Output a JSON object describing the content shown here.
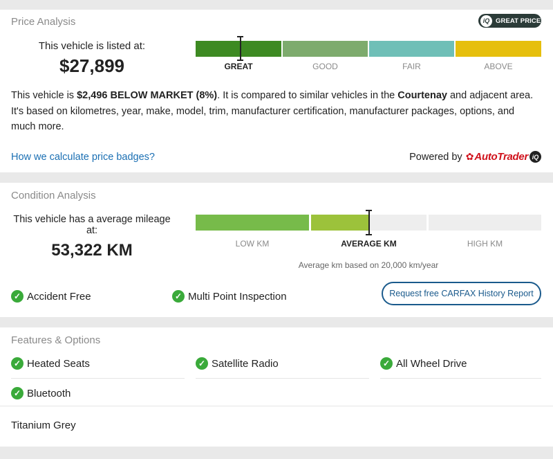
{
  "price_analysis": {
    "title": "Price Analysis",
    "badge": {
      "icon": "iq-icon",
      "iq": "iQ",
      "text": "GREAT PRICE"
    },
    "listed_label": "This vehicle is listed at:",
    "price": "$27,899",
    "bar_labels": [
      "GREAT",
      "GOOD",
      "FAIR",
      "ABOVE"
    ],
    "active_segment": "GREAT",
    "desc_pre": "This vehicle is ",
    "desc_amount": "$2,496 BELOW MARKET (8%)",
    "desc_mid": ". It is compared to similar vehicles in the ",
    "desc_city": "Courtenay",
    "desc_post": " and adjacent area. It's based on kilometres, year, make, model, trim, manufacturer certification, manufacturer packages, options, and much more.",
    "link": "How we calculate price badges?",
    "powered_by": "Powered by",
    "autotrader": "AutoTrader",
    "autotrader_iq": "iQ"
  },
  "condition_analysis": {
    "title": "Condition Analysis",
    "mileage_label": "This vehicle has a average mileage at:",
    "mileage": "53,322 KM",
    "bar_labels": [
      "LOW KM",
      "AVERAGE KM",
      "HIGH KM"
    ],
    "active_segment": "AVERAGE KM",
    "note": "Average km based on 20,000 km/year",
    "checks": [
      "Accident Free",
      "Multi Point Inspection"
    ],
    "carfax_button": "Request free CARFAX History Report"
  },
  "features": {
    "title": "Features & Options",
    "items": [
      "Heated Seats",
      "Satellite Radio",
      "All Wheel Drive",
      "Bluetooth"
    ],
    "color": "Titanium Grey"
  },
  "colors": {
    "great": "#3d8a22",
    "good": "#7dab6d",
    "fair": "#6fbfb7",
    "above": "#e6bf0d",
    "low_km": "#77bb4a",
    "average_km": "#9cc23b",
    "empty_seg": "#eeeeee",
    "link": "#1a6fb3",
    "check": "#3aaa3a"
  }
}
